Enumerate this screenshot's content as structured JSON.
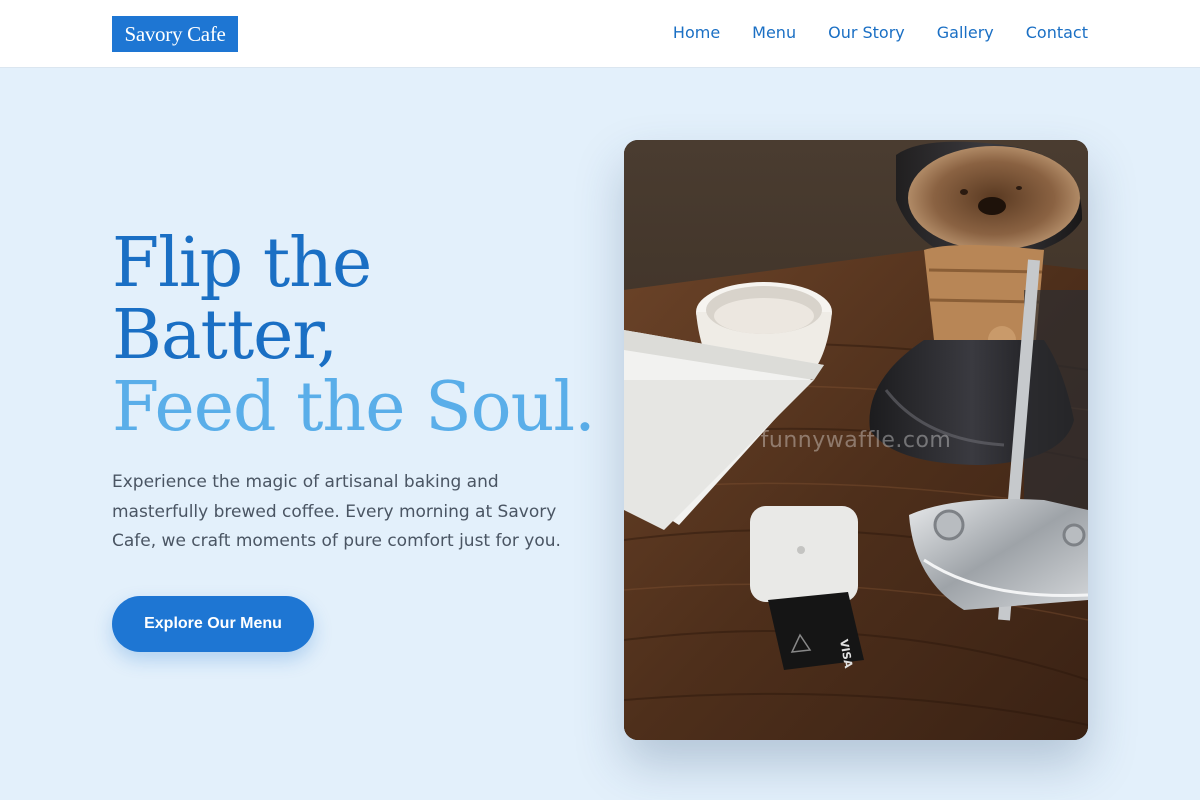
{
  "brand": {
    "name": "Savory Cafe"
  },
  "nav": {
    "items": [
      {
        "label": "Home"
      },
      {
        "label": "Menu"
      },
      {
        "label": "Our Story"
      },
      {
        "label": "Gallery"
      },
      {
        "label": "Contact"
      }
    ]
  },
  "hero": {
    "title_line1": "Flip the",
    "title_line2": "Batter,",
    "title_line3": "Feed the Soul.",
    "description": "Experience the magic of artisanal baking and masterfully brewed coffee. Every morning at Savory Cafe, we craft moments of pure comfort just for you.",
    "cta_label": "Explore Our Menu",
    "image_watermark": "funnywaffle.com"
  },
  "colors": {
    "primary": "#1e76d3",
    "nav_text": "#1a6fc4",
    "title_light": "#5aaee9",
    "background": "#e3f0fb",
    "body_text": "#4a5563"
  }
}
